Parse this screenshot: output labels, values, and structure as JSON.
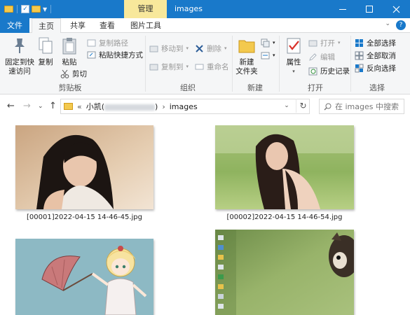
{
  "titlebar": {
    "context_tab": "管理",
    "title": "images"
  },
  "tabs": {
    "file": "文件",
    "home": "主页",
    "share": "共享",
    "view": "查看",
    "picture_tools": "图片工具"
  },
  "ribbon": {
    "clipboard": {
      "label": "剪贴板",
      "pin": "固定到快\n速访问",
      "copy": "复制",
      "paste": "粘贴",
      "copy_path": "复制路径",
      "paste_shortcut": "粘贴快捷方式",
      "cut": "剪切"
    },
    "organize": {
      "label": "组织",
      "move_to": "移动到",
      "copy_to": "复制到",
      "delete": "删除",
      "rename": "重命名"
    },
    "new": {
      "label": "新建",
      "new_folder": "新建\n文件夹"
    },
    "open": {
      "label": "打开",
      "properties": "属性",
      "open": "打开",
      "edit": "编辑",
      "history": "历史记录"
    },
    "select": {
      "label": "选择",
      "select_all": "全部选择",
      "select_none": "全部取消",
      "invert": "反向选择"
    }
  },
  "address": {
    "prefix": "«",
    "crumb_user": "小凯(",
    "crumb_user_end": ")",
    "crumb_current": "images",
    "separator": "›"
  },
  "search": {
    "placeholder": "在 images 中搜索"
  },
  "files": [
    {
      "name": "[00001]2022-04-15 14-46-45.jpg"
    },
    {
      "name": "[00002]2022-04-15 14-46-54.jpg"
    }
  ],
  "colors": {
    "titlebar": "#1979ca",
    "context_tab": "#f8e89b",
    "ribbon_bg": "#f5f6f7"
  }
}
